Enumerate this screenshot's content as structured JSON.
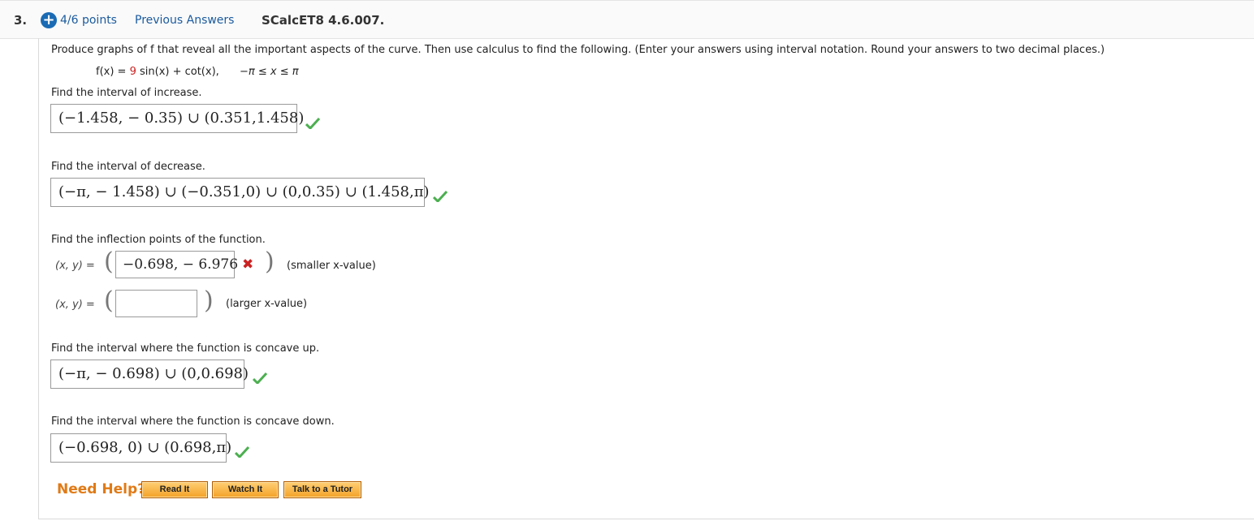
{
  "header": {
    "question_number": "3.",
    "points": "4/6 points",
    "previous_answers": "Previous Answers",
    "problem_id": "SCalcET8 4.6.007."
  },
  "problem": {
    "instructions": "Produce graphs of f that reveal all the important aspects of the curve. Then use calculus to find the following. (Enter your answers using interval notation. Round your answers to two decimal places.)",
    "fx_prefix": "f(x) = ",
    "fx_coef": "9",
    "fx_rest": " sin(x) + cot(x),",
    "domain": "−π ≤ x ≤ π"
  },
  "increase": {
    "prompt": "Find the interval of increase.",
    "answer": "(−1.458, − 0.35) ∪ (0.351,1.458)",
    "status": "correct"
  },
  "decrease": {
    "prompt": "Find the interval of decrease.",
    "answer": "(−π, − 1.458) ∪ (−0.351,0) ∪ (0,0.35) ∪ (1.458,π)",
    "status": "correct"
  },
  "inflection": {
    "prompt": "Find the inflection points of the function.",
    "xy_label": "(x, y) =",
    "first_answer": "−0.698, − 6.976",
    "first_status": "incorrect",
    "first_hint": "(smaller x-value)",
    "second_answer": "",
    "second_hint": "(larger x-value)"
  },
  "concave_up": {
    "prompt": "Find the interval where the function is concave up.",
    "answer": "(−π, − 0.698) ∪ (0,0.698)",
    "status": "correct"
  },
  "concave_down": {
    "prompt": "Find the interval where the function is concave down.",
    "answer": "(−0.698, 0) ∪ (0.698,π)",
    "status": "correct"
  },
  "help": {
    "label": "Need Help?",
    "read_it": "Read It",
    "watch_it": "Watch It",
    "talk_tutor": "Talk to a Tutor"
  },
  "colors": {
    "link": "#1a5a9e",
    "correct": "#4caf50",
    "incorrect": "#cc2222",
    "help_orange": "#e07a16"
  },
  "icons": {
    "points": "plus-circle-icon",
    "correct": "checkmark-icon",
    "incorrect": "x-mark-icon"
  }
}
